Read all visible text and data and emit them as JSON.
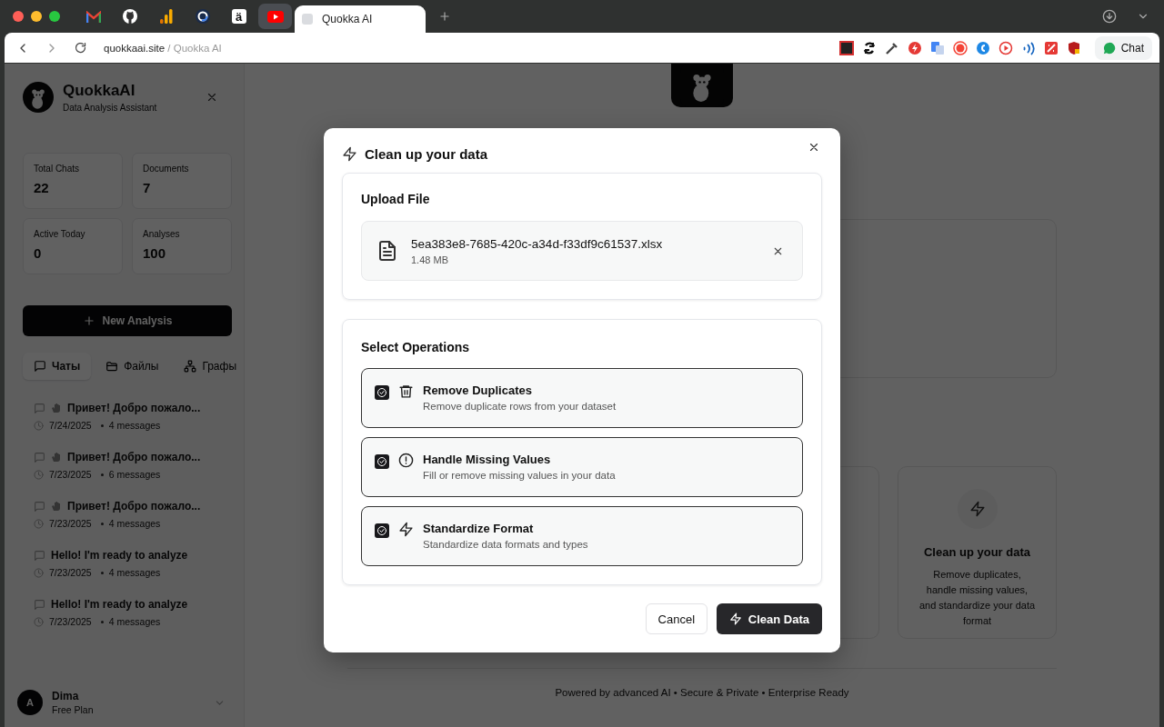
{
  "browser": {
    "pinned_tabs": [
      {
        "kind": "mail",
        "hovered": false
      },
      {
        "kind": "octocat",
        "hovered": false
      },
      {
        "kind": "bars",
        "hovered": false
      },
      {
        "kind": "ring",
        "hovered": false
      },
      {
        "kind": "letter",
        "glyph": "ä",
        "hovered": false
      },
      {
        "kind": "play",
        "hovered": true
      }
    ],
    "tab": {
      "title": "Quokka AI",
      "selected": true
    },
    "address": {
      "domain": "quokkaai.site",
      "page": "/ Quokka AI"
    },
    "chat_button": "Chat"
  },
  "sidebar": {
    "app_name": "QuokkaAI",
    "subtitle": "Data Analysis Assistant",
    "stats": [
      {
        "label": "Total Chats",
        "value": "22"
      },
      {
        "label": "Documents",
        "value": "7"
      },
      {
        "label": "Active Today",
        "value": "0"
      },
      {
        "label": "Analyses",
        "value": "100"
      }
    ],
    "new_button": "New Analysis",
    "tabs": [
      {
        "label": "Чаты",
        "kind": "chat",
        "selected": true
      },
      {
        "label": "Файлы",
        "kind": "folder",
        "selected": false
      },
      {
        "label": "Графы",
        "kind": "graph",
        "selected": false
      }
    ],
    "chats": [
      {
        "title": "Привет! Добро пожало...",
        "greeting": true,
        "date": "7/24/2025",
        "count": "4 messages"
      },
      {
        "title": "Привет! Добро пожало...",
        "greeting": true,
        "date": "7/23/2025",
        "count": "6 messages"
      },
      {
        "title": "Привет! Добро пожало...",
        "greeting": true,
        "date": "7/23/2025",
        "count": "4 messages"
      },
      {
        "title": "Hello! I'm ready to analyze",
        "greeting": false,
        "date": "7/23/2025",
        "count": "4 messages"
      },
      {
        "title": "Hello! I'm ready to analyze",
        "greeting": false,
        "date": "7/23/2025",
        "count": "4 messages"
      }
    ],
    "user": {
      "initial": "A",
      "name": "Dima",
      "plan": "Free Plan"
    }
  },
  "main": {
    "feature_card": {
      "title": "Clean up your data",
      "description": "Remove duplicates, handle missing values, and standardize your data format"
    },
    "footer": "Powered by advanced AI • Secure & Private • Enterprise Ready"
  },
  "dialog": {
    "title": "Clean up your data",
    "upload_title": "Upload File",
    "file": {
      "name": "5ea383e8-7685-420c-a34d-f33df9c61537.xlsx",
      "size": "1.48 MB"
    },
    "operations_title": "Select Operations",
    "operations": [
      {
        "kind": "duplicates",
        "title": "Remove Duplicates",
        "description": "Remove duplicate rows from your dataset",
        "checked": true
      },
      {
        "kind": "missing",
        "title": "Handle Missing Values",
        "description": "Fill or remove missing values in your data",
        "checked": true
      },
      {
        "kind": "format",
        "title": "Standardize Format",
        "description": "Standardize data formats and types",
        "checked": true
      }
    ],
    "cancel_button": "Cancel",
    "confirm_button": "Clean Data"
  }
}
